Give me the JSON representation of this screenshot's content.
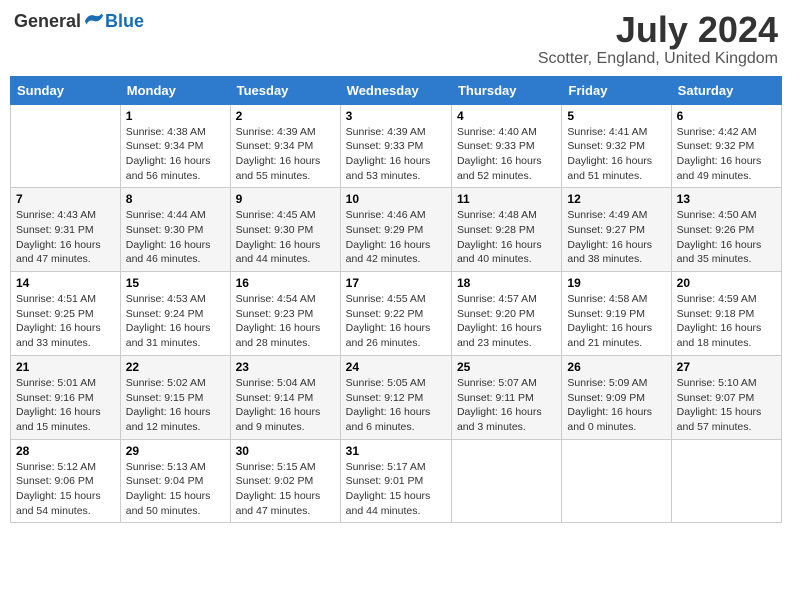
{
  "header": {
    "logo_general": "General",
    "logo_blue": "Blue",
    "month_year": "July 2024",
    "location": "Scotter, England, United Kingdom"
  },
  "days_of_week": [
    "Sunday",
    "Monday",
    "Tuesday",
    "Wednesday",
    "Thursday",
    "Friday",
    "Saturday"
  ],
  "weeks": [
    [
      {
        "day": "",
        "sunrise": "",
        "sunset": "",
        "daylight": ""
      },
      {
        "day": "1",
        "sunrise": "Sunrise: 4:38 AM",
        "sunset": "Sunset: 9:34 PM",
        "daylight": "Daylight: 16 hours and 56 minutes."
      },
      {
        "day": "2",
        "sunrise": "Sunrise: 4:39 AM",
        "sunset": "Sunset: 9:34 PM",
        "daylight": "Daylight: 16 hours and 55 minutes."
      },
      {
        "day": "3",
        "sunrise": "Sunrise: 4:39 AM",
        "sunset": "Sunset: 9:33 PM",
        "daylight": "Daylight: 16 hours and 53 minutes."
      },
      {
        "day": "4",
        "sunrise": "Sunrise: 4:40 AM",
        "sunset": "Sunset: 9:33 PM",
        "daylight": "Daylight: 16 hours and 52 minutes."
      },
      {
        "day": "5",
        "sunrise": "Sunrise: 4:41 AM",
        "sunset": "Sunset: 9:32 PM",
        "daylight": "Daylight: 16 hours and 51 minutes."
      },
      {
        "day": "6",
        "sunrise": "Sunrise: 4:42 AM",
        "sunset": "Sunset: 9:32 PM",
        "daylight": "Daylight: 16 hours and 49 minutes."
      }
    ],
    [
      {
        "day": "7",
        "sunrise": "Sunrise: 4:43 AM",
        "sunset": "Sunset: 9:31 PM",
        "daylight": "Daylight: 16 hours and 47 minutes."
      },
      {
        "day": "8",
        "sunrise": "Sunrise: 4:44 AM",
        "sunset": "Sunset: 9:30 PM",
        "daylight": "Daylight: 16 hours and 46 minutes."
      },
      {
        "day": "9",
        "sunrise": "Sunrise: 4:45 AM",
        "sunset": "Sunset: 9:30 PM",
        "daylight": "Daylight: 16 hours and 44 minutes."
      },
      {
        "day": "10",
        "sunrise": "Sunrise: 4:46 AM",
        "sunset": "Sunset: 9:29 PM",
        "daylight": "Daylight: 16 hours and 42 minutes."
      },
      {
        "day": "11",
        "sunrise": "Sunrise: 4:48 AM",
        "sunset": "Sunset: 9:28 PM",
        "daylight": "Daylight: 16 hours and 40 minutes."
      },
      {
        "day": "12",
        "sunrise": "Sunrise: 4:49 AM",
        "sunset": "Sunset: 9:27 PM",
        "daylight": "Daylight: 16 hours and 38 minutes."
      },
      {
        "day": "13",
        "sunrise": "Sunrise: 4:50 AM",
        "sunset": "Sunset: 9:26 PM",
        "daylight": "Daylight: 16 hours and 35 minutes."
      }
    ],
    [
      {
        "day": "14",
        "sunrise": "Sunrise: 4:51 AM",
        "sunset": "Sunset: 9:25 PM",
        "daylight": "Daylight: 16 hours and 33 minutes."
      },
      {
        "day": "15",
        "sunrise": "Sunrise: 4:53 AM",
        "sunset": "Sunset: 9:24 PM",
        "daylight": "Daylight: 16 hours and 31 minutes."
      },
      {
        "day": "16",
        "sunrise": "Sunrise: 4:54 AM",
        "sunset": "Sunset: 9:23 PM",
        "daylight": "Daylight: 16 hours and 28 minutes."
      },
      {
        "day": "17",
        "sunrise": "Sunrise: 4:55 AM",
        "sunset": "Sunset: 9:22 PM",
        "daylight": "Daylight: 16 hours and 26 minutes."
      },
      {
        "day": "18",
        "sunrise": "Sunrise: 4:57 AM",
        "sunset": "Sunset: 9:20 PM",
        "daylight": "Daylight: 16 hours and 23 minutes."
      },
      {
        "day": "19",
        "sunrise": "Sunrise: 4:58 AM",
        "sunset": "Sunset: 9:19 PM",
        "daylight": "Daylight: 16 hours and 21 minutes."
      },
      {
        "day": "20",
        "sunrise": "Sunrise: 4:59 AM",
        "sunset": "Sunset: 9:18 PM",
        "daylight": "Daylight: 16 hours and 18 minutes."
      }
    ],
    [
      {
        "day": "21",
        "sunrise": "Sunrise: 5:01 AM",
        "sunset": "Sunset: 9:16 PM",
        "daylight": "Daylight: 16 hours and 15 minutes."
      },
      {
        "day": "22",
        "sunrise": "Sunrise: 5:02 AM",
        "sunset": "Sunset: 9:15 PM",
        "daylight": "Daylight: 16 hours and 12 minutes."
      },
      {
        "day": "23",
        "sunrise": "Sunrise: 5:04 AM",
        "sunset": "Sunset: 9:14 PM",
        "daylight": "Daylight: 16 hours and 9 minutes."
      },
      {
        "day": "24",
        "sunrise": "Sunrise: 5:05 AM",
        "sunset": "Sunset: 9:12 PM",
        "daylight": "Daylight: 16 hours and 6 minutes."
      },
      {
        "day": "25",
        "sunrise": "Sunrise: 5:07 AM",
        "sunset": "Sunset: 9:11 PM",
        "daylight": "Daylight: 16 hours and 3 minutes."
      },
      {
        "day": "26",
        "sunrise": "Sunrise: 5:09 AM",
        "sunset": "Sunset: 9:09 PM",
        "daylight": "Daylight: 16 hours and 0 minutes."
      },
      {
        "day": "27",
        "sunrise": "Sunrise: 5:10 AM",
        "sunset": "Sunset: 9:07 PM",
        "daylight": "Daylight: 15 hours and 57 minutes."
      }
    ],
    [
      {
        "day": "28",
        "sunrise": "Sunrise: 5:12 AM",
        "sunset": "Sunset: 9:06 PM",
        "daylight": "Daylight: 15 hours and 54 minutes."
      },
      {
        "day": "29",
        "sunrise": "Sunrise: 5:13 AM",
        "sunset": "Sunset: 9:04 PM",
        "daylight": "Daylight: 15 hours and 50 minutes."
      },
      {
        "day": "30",
        "sunrise": "Sunrise: 5:15 AM",
        "sunset": "Sunset: 9:02 PM",
        "daylight": "Daylight: 15 hours and 47 minutes."
      },
      {
        "day": "31",
        "sunrise": "Sunrise: 5:17 AM",
        "sunset": "Sunset: 9:01 PM",
        "daylight": "Daylight: 15 hours and 44 minutes."
      },
      {
        "day": "",
        "sunrise": "",
        "sunset": "",
        "daylight": ""
      },
      {
        "day": "",
        "sunrise": "",
        "sunset": "",
        "daylight": ""
      },
      {
        "day": "",
        "sunrise": "",
        "sunset": "",
        "daylight": ""
      }
    ]
  ]
}
